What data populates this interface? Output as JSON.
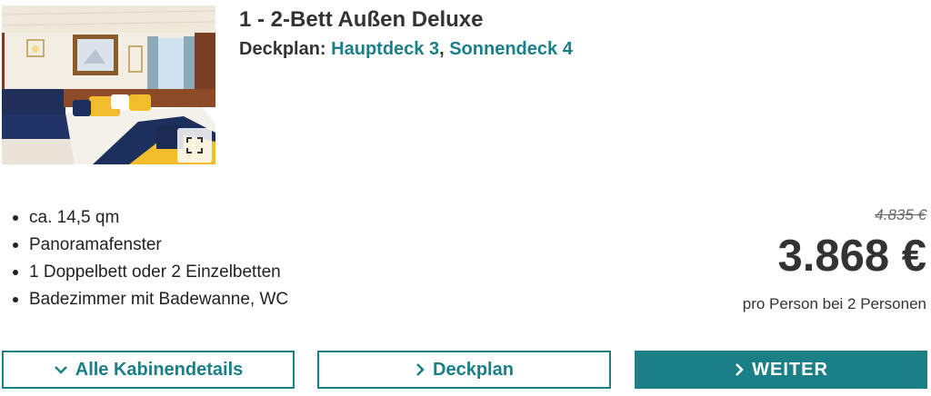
{
  "cabin": {
    "title": "1 - 2-Bett Außen Deluxe",
    "deck_label": "Deckplan:",
    "decks": [
      "Hauptdeck 3",
      "Sonnendeck 4"
    ],
    "deck_separator": ","
  },
  "image": {
    "expand_icon": "expand-icon"
  },
  "features": [
    "ca. 14,5 qm",
    "Panoramafenster",
    "1 Doppelbett oder 2 Einzelbetten",
    "Badezimmer mit Badewanne, WC"
  ],
  "pricing": {
    "old_price": "4.835 €",
    "price": "3.868 €",
    "note": "pro Person bei 2 Personen"
  },
  "buttons": {
    "details_label": "Alle Kabinendetails",
    "deckplan_label": "Deckplan",
    "continue_label": "WEITER"
  },
  "colors": {
    "accent": "#1a7f86",
    "text": "#333333"
  }
}
